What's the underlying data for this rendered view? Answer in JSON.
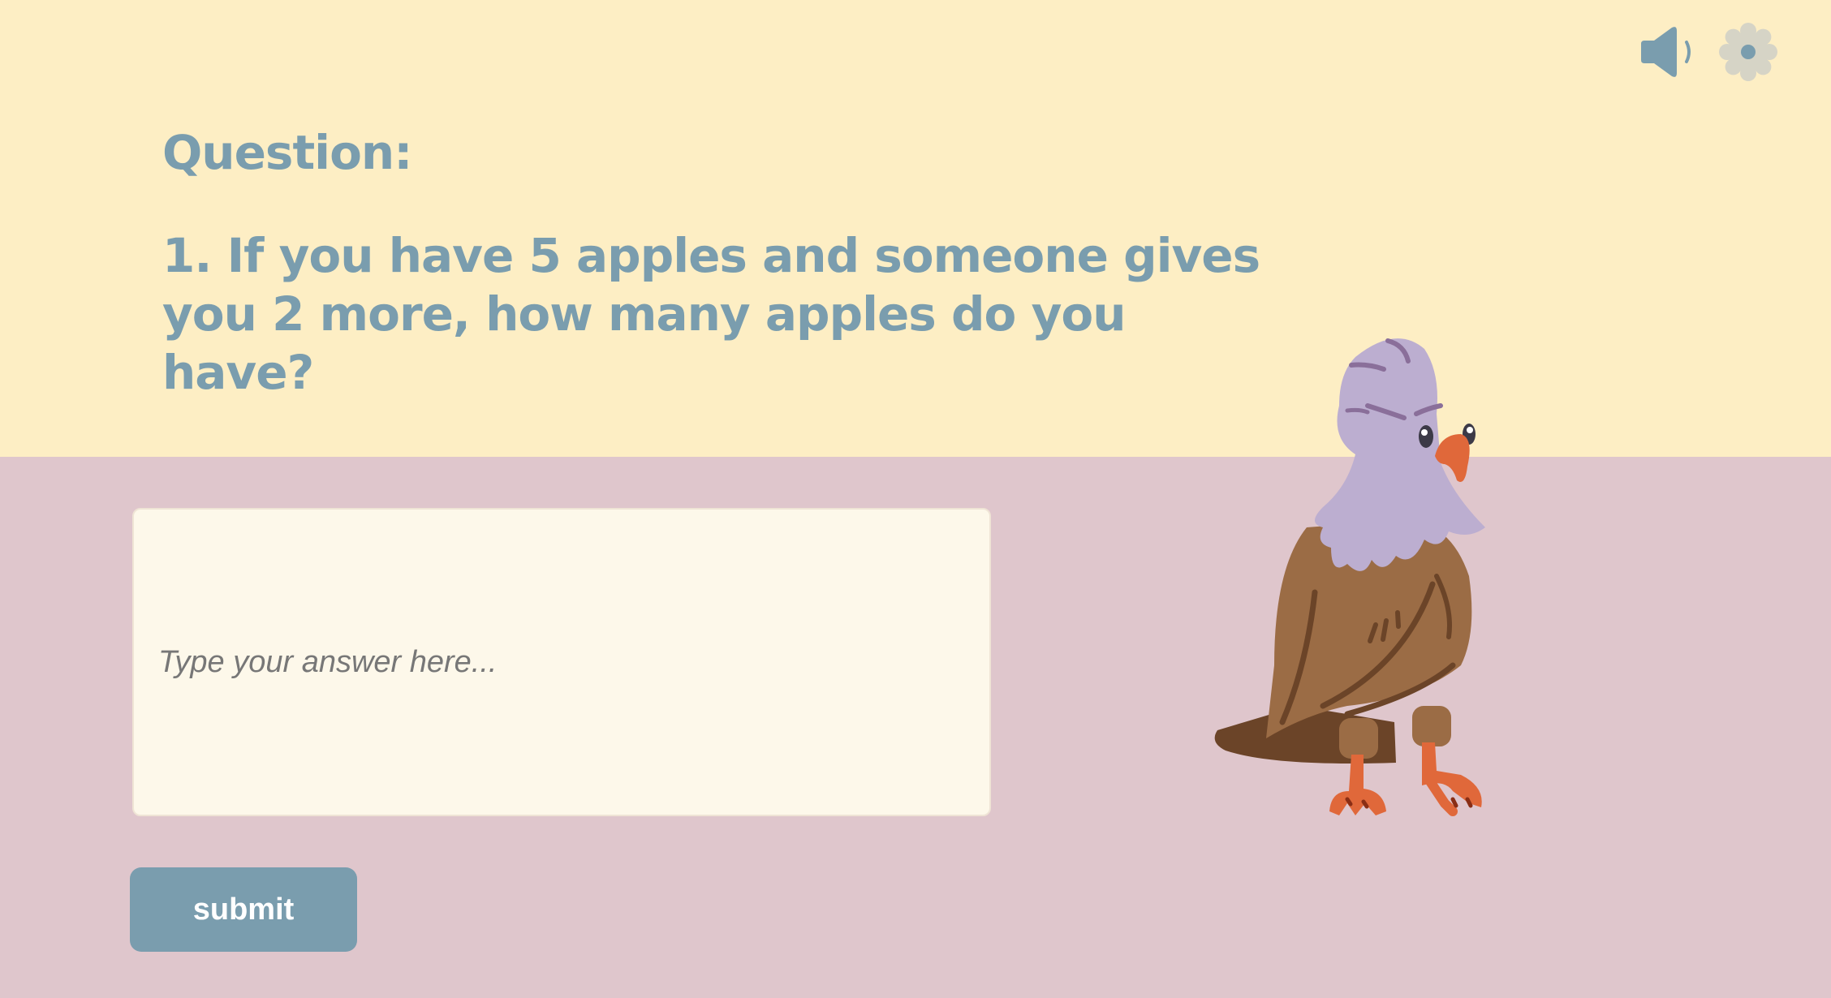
{
  "question": {
    "heading": "Question:",
    "text": "1. If you have 5 apples and someone gives you 2 more, how many apples do you have?"
  },
  "answer": {
    "placeholder": "Type your answer here...",
    "value": ""
  },
  "submit": {
    "label": "submit"
  },
  "toolbar": {
    "sound_icon": "speaker-icon",
    "settings_icon": "gear-icon"
  },
  "colors": {
    "top_background": "#fdeec4",
    "bottom_background": "#dfc6cc",
    "accent": "#7a9dae",
    "input_background": "#fdf8ea",
    "settings_gear": "#d6d4c6"
  },
  "illustration": {
    "name": "eagle-mascot"
  }
}
